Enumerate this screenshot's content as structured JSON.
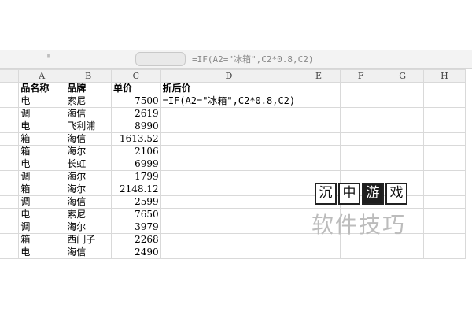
{
  "formula_bar": {
    "name_box": "ᴵᴵ",
    "text": "=IF(A2=\"冰箱\",C2*0.8,C2)"
  },
  "columns": [
    "A",
    "B",
    "C",
    "D",
    "E",
    "F",
    "G",
    "H"
  ],
  "header_row": {
    "a": "品名称",
    "b": "品牌",
    "c": "单价",
    "d": "折后价"
  },
  "rows": [
    {
      "a": "电",
      "b": "索尼",
      "c": "7500",
      "d": "=IF(A2=\"冰箱\",C2*0.8,C2)"
    },
    {
      "a": "调",
      "b": "海信",
      "c": "2619",
      "d": ""
    },
    {
      "a": "电",
      "b": "飞利浦",
      "c": "8990",
      "d": ""
    },
    {
      "a": "箱",
      "b": "海信",
      "c": "1613.52",
      "d": ""
    },
    {
      "a": "箱",
      "b": "海尔",
      "c": "2106",
      "d": ""
    },
    {
      "a": "电",
      "b": "长虹",
      "c": "6999",
      "d": ""
    },
    {
      "a": "调",
      "b": "海尔",
      "c": "1799",
      "d": ""
    },
    {
      "a": "箱",
      "b": "海尔",
      "c": "2148.12",
      "d": ""
    },
    {
      "a": "调",
      "b": "海信",
      "c": "2599",
      "d": ""
    },
    {
      "a": "电",
      "b": "索尼",
      "c": "7650",
      "d": ""
    },
    {
      "a": "调",
      "b": "海尔",
      "c": "3979",
      "d": ""
    },
    {
      "a": "箱",
      "b": "西门子",
      "c": "2268",
      "d": ""
    },
    {
      "a": "电",
      "b": "海信",
      "c": "2490",
      "d": ""
    }
  ],
  "watermark": {
    "tiles": [
      "沉",
      "中",
      "游",
      "戏"
    ],
    "text": "软件技巧"
  }
}
